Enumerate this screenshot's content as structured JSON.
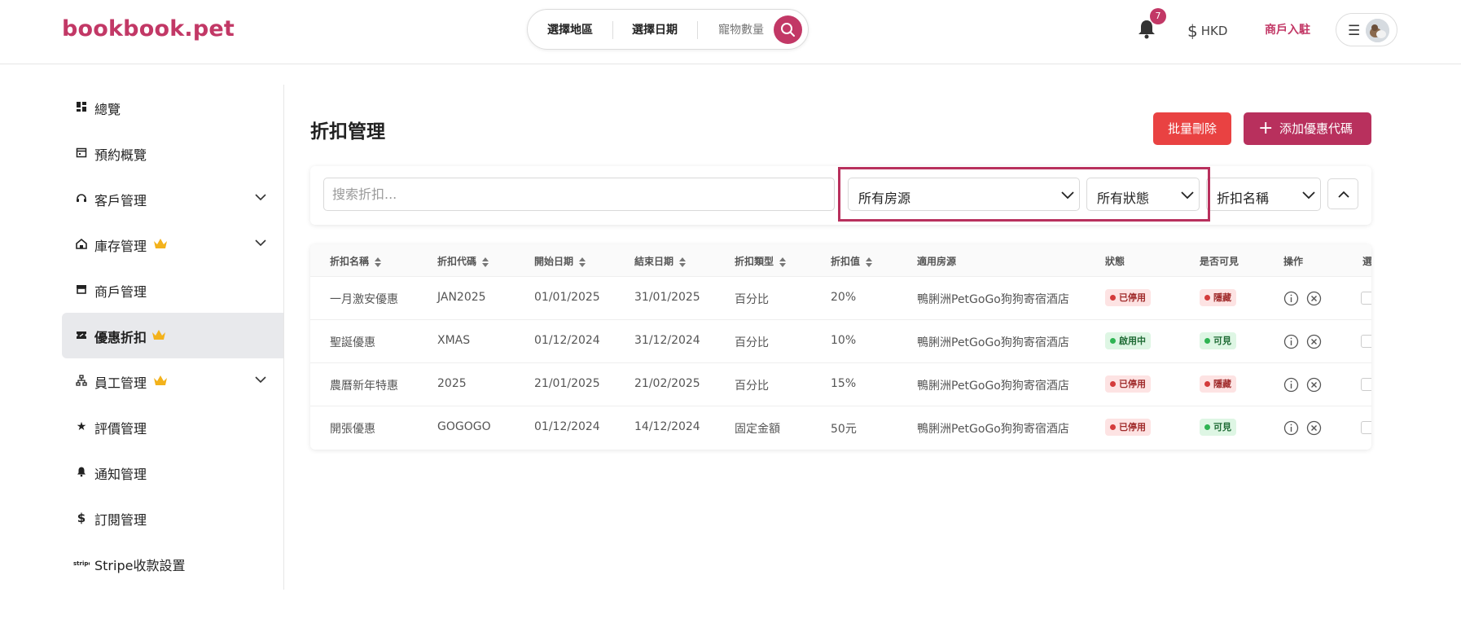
{
  "header": {
    "logo": "bookbook.pet",
    "search": {
      "region": "選擇地區",
      "date": "選擇日期",
      "pets": "寵物數量"
    },
    "notification_count": "7",
    "currency": "HKD",
    "merchant_link": "商戶入駐"
  },
  "sidebar": {
    "items": [
      {
        "label": "總覽",
        "icon": "dashboard-icon"
      },
      {
        "label": "預約概覽",
        "icon": "calendar-icon"
      },
      {
        "label": "客戶管理",
        "icon": "headset-icon",
        "expandable": true
      },
      {
        "label": "庫存管理",
        "icon": "house-icon",
        "premium": true,
        "expandable": true
      },
      {
        "label": "商戶管理",
        "icon": "store-icon"
      },
      {
        "label": "優惠折扣",
        "icon": "ticket-icon",
        "premium": true,
        "active": true
      },
      {
        "label": "員工管理",
        "icon": "org-chart-icon",
        "premium": true,
        "expandable": true
      },
      {
        "label": "評價管理",
        "icon": "star-icon"
      },
      {
        "label": "通知管理",
        "icon": "bell-icon"
      },
      {
        "label": "訂閱管理",
        "icon": "dollar-icon"
      },
      {
        "label": "Stripe收款設置",
        "icon": "stripe-icon"
      }
    ]
  },
  "main": {
    "title": "折扣管理",
    "bulk_delete": "批量刪除",
    "add_coupon": "添加優惠代碼",
    "filters": {
      "search_placeholder": "搜索折扣...",
      "property": "所有房源",
      "status": "所有狀態",
      "sort_by": "折扣名稱"
    },
    "table": {
      "columns": [
        "折扣名稱",
        "折扣代碼",
        "開始日期",
        "結束日期",
        "折扣類型",
        "折扣值",
        "適用房源",
        "狀態",
        "是否可見",
        "操作",
        "選"
      ],
      "rows": [
        {
          "name": "一月激安優惠",
          "code": "JAN2025",
          "start": "01/01/2025",
          "end": "31/01/2025",
          "type": "百分比",
          "value": "20%",
          "property": "鴨脷洲PetGoGo狗狗寄宿酒店",
          "status": "已停用",
          "status_kind": "red",
          "visibility": "隱藏",
          "visibility_kind": "red"
        },
        {
          "name": "聖誕優惠",
          "code": "XMAS",
          "start": "01/12/2024",
          "end": "31/12/2024",
          "type": "百分比",
          "value": "10%",
          "property": "鴨脷洲PetGoGo狗狗寄宿酒店",
          "status": "啟用中",
          "status_kind": "green",
          "visibility": "可見",
          "visibility_kind": "green"
        },
        {
          "name": "農曆新年特惠",
          "code": "2025",
          "start": "21/01/2025",
          "end": "21/02/2025",
          "type": "百分比",
          "value": "15%",
          "property": "鴨脷洲PetGoGo狗狗寄宿酒店",
          "status": "已停用",
          "status_kind": "red",
          "visibility": "隱藏",
          "visibility_kind": "red"
        },
        {
          "name": "開張優惠",
          "code": "GOGOGO",
          "start": "01/12/2024",
          "end": "14/12/2024",
          "type": "固定金額",
          "value": "50元",
          "property": "鴨脷洲PetGoGo狗狗寄宿酒店",
          "status": "已停用",
          "status_kind": "red",
          "visibility": "可見",
          "visibility_kind": "green"
        }
      ]
    }
  },
  "colors": {
    "brand": "#c23866",
    "danger": "#e94242",
    "primary_button": "#b8305d",
    "highlight_border": "#b8305d"
  }
}
